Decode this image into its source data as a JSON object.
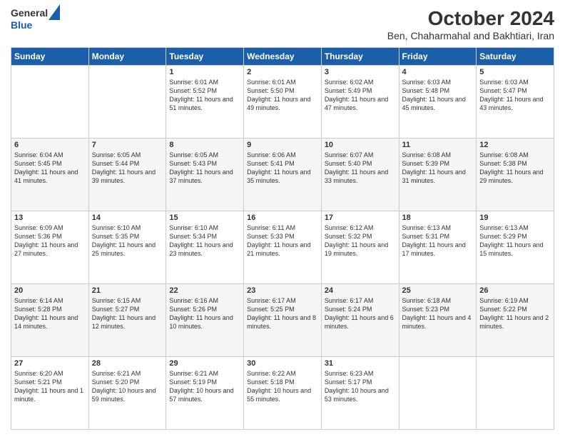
{
  "logo": {
    "line1": "General",
    "line2": "Blue"
  },
  "title": "October 2024",
  "subtitle": "Ben, Chaharmahal and Bakhtiari, Iran",
  "days": [
    "Sunday",
    "Monday",
    "Tuesday",
    "Wednesday",
    "Thursday",
    "Friday",
    "Saturday"
  ],
  "weeks": [
    [
      {
        "day": "",
        "content": ""
      },
      {
        "day": "",
        "content": ""
      },
      {
        "day": "1",
        "content": "Sunrise: 6:01 AM\nSunset: 5:52 PM\nDaylight: 11 hours and 51 minutes."
      },
      {
        "day": "2",
        "content": "Sunrise: 6:01 AM\nSunset: 5:50 PM\nDaylight: 11 hours and 49 minutes."
      },
      {
        "day": "3",
        "content": "Sunrise: 6:02 AM\nSunset: 5:49 PM\nDaylight: 11 hours and 47 minutes."
      },
      {
        "day": "4",
        "content": "Sunrise: 6:03 AM\nSunset: 5:48 PM\nDaylight: 11 hours and 45 minutes."
      },
      {
        "day": "5",
        "content": "Sunrise: 6:03 AM\nSunset: 5:47 PM\nDaylight: 11 hours and 43 minutes."
      }
    ],
    [
      {
        "day": "6",
        "content": "Sunrise: 6:04 AM\nSunset: 5:45 PM\nDaylight: 11 hours and 41 minutes."
      },
      {
        "day": "7",
        "content": "Sunrise: 6:05 AM\nSunset: 5:44 PM\nDaylight: 11 hours and 39 minutes."
      },
      {
        "day": "8",
        "content": "Sunrise: 6:05 AM\nSunset: 5:43 PM\nDaylight: 11 hours and 37 minutes."
      },
      {
        "day": "9",
        "content": "Sunrise: 6:06 AM\nSunset: 5:41 PM\nDaylight: 11 hours and 35 minutes."
      },
      {
        "day": "10",
        "content": "Sunrise: 6:07 AM\nSunset: 5:40 PM\nDaylight: 11 hours and 33 minutes."
      },
      {
        "day": "11",
        "content": "Sunrise: 6:08 AM\nSunset: 5:39 PM\nDaylight: 11 hours and 31 minutes."
      },
      {
        "day": "12",
        "content": "Sunrise: 6:08 AM\nSunset: 5:38 PM\nDaylight: 11 hours and 29 minutes."
      }
    ],
    [
      {
        "day": "13",
        "content": "Sunrise: 6:09 AM\nSunset: 5:36 PM\nDaylight: 11 hours and 27 minutes."
      },
      {
        "day": "14",
        "content": "Sunrise: 6:10 AM\nSunset: 5:35 PM\nDaylight: 11 hours and 25 minutes."
      },
      {
        "day": "15",
        "content": "Sunrise: 6:10 AM\nSunset: 5:34 PM\nDaylight: 11 hours and 23 minutes."
      },
      {
        "day": "16",
        "content": "Sunrise: 6:11 AM\nSunset: 5:33 PM\nDaylight: 11 hours and 21 minutes."
      },
      {
        "day": "17",
        "content": "Sunrise: 6:12 AM\nSunset: 5:32 PM\nDaylight: 11 hours and 19 minutes."
      },
      {
        "day": "18",
        "content": "Sunrise: 6:13 AM\nSunset: 5:31 PM\nDaylight: 11 hours and 17 minutes."
      },
      {
        "day": "19",
        "content": "Sunrise: 6:13 AM\nSunset: 5:29 PM\nDaylight: 11 hours and 15 minutes."
      }
    ],
    [
      {
        "day": "20",
        "content": "Sunrise: 6:14 AM\nSunset: 5:28 PM\nDaylight: 11 hours and 14 minutes."
      },
      {
        "day": "21",
        "content": "Sunrise: 6:15 AM\nSunset: 5:27 PM\nDaylight: 11 hours and 12 minutes."
      },
      {
        "day": "22",
        "content": "Sunrise: 6:16 AM\nSunset: 5:26 PM\nDaylight: 11 hours and 10 minutes."
      },
      {
        "day": "23",
        "content": "Sunrise: 6:17 AM\nSunset: 5:25 PM\nDaylight: 11 hours and 8 minutes."
      },
      {
        "day": "24",
        "content": "Sunrise: 6:17 AM\nSunset: 5:24 PM\nDaylight: 11 hours and 6 minutes."
      },
      {
        "day": "25",
        "content": "Sunrise: 6:18 AM\nSunset: 5:23 PM\nDaylight: 11 hours and 4 minutes."
      },
      {
        "day": "26",
        "content": "Sunrise: 6:19 AM\nSunset: 5:22 PM\nDaylight: 11 hours and 2 minutes."
      }
    ],
    [
      {
        "day": "27",
        "content": "Sunrise: 6:20 AM\nSunset: 5:21 PM\nDaylight: 11 hours and 1 minute."
      },
      {
        "day": "28",
        "content": "Sunrise: 6:21 AM\nSunset: 5:20 PM\nDaylight: 10 hours and 59 minutes."
      },
      {
        "day": "29",
        "content": "Sunrise: 6:21 AM\nSunset: 5:19 PM\nDaylight: 10 hours and 57 minutes."
      },
      {
        "day": "30",
        "content": "Sunrise: 6:22 AM\nSunset: 5:18 PM\nDaylight: 10 hours and 55 minutes."
      },
      {
        "day": "31",
        "content": "Sunrise: 6:23 AM\nSunset: 5:17 PM\nDaylight: 10 hours and 53 minutes."
      },
      {
        "day": "",
        "content": ""
      },
      {
        "day": "",
        "content": ""
      }
    ]
  ]
}
